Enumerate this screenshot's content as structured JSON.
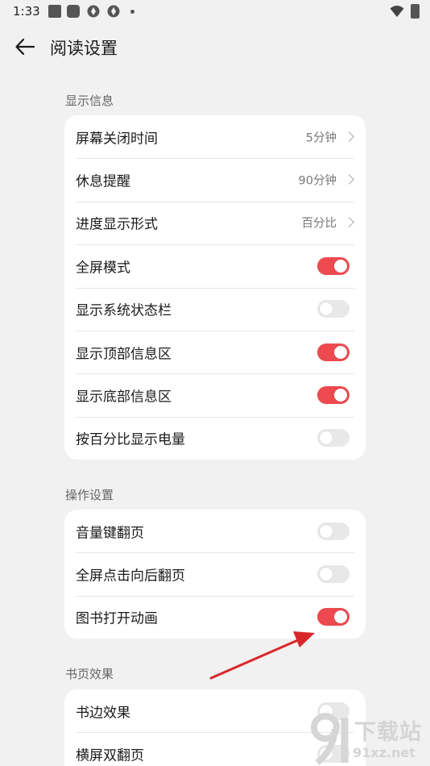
{
  "status_bar": {
    "time": "1:33"
  },
  "header": {
    "title": "阅读设置"
  },
  "sections": [
    {
      "title": "显示信息",
      "rows": [
        {
          "label": "屏幕关闭时间",
          "type": "nav",
          "value": "5分钟"
        },
        {
          "label": "休息提醒",
          "type": "nav",
          "value": "90分钟"
        },
        {
          "label": "进度显示形式",
          "type": "nav",
          "value": "百分比"
        },
        {
          "label": "全屏模式",
          "type": "toggle",
          "on": true
        },
        {
          "label": "显示系统状态栏",
          "type": "toggle",
          "on": false
        },
        {
          "label": "显示顶部信息区",
          "type": "toggle",
          "on": true
        },
        {
          "label": "显示底部信息区",
          "type": "toggle",
          "on": true
        },
        {
          "label": "按百分比显示电量",
          "type": "toggle",
          "on": false
        }
      ]
    },
    {
      "title": "操作设置",
      "rows": [
        {
          "label": "音量键翻页",
          "type": "toggle",
          "on": false
        },
        {
          "label": "全屏点击向后翻页",
          "type": "toggle",
          "on": false
        },
        {
          "label": "图书打开动画",
          "type": "toggle",
          "on": true
        }
      ]
    },
    {
      "title": "书页效果",
      "rows": [
        {
          "label": "书边效果",
          "type": "toggle",
          "on": false
        },
        {
          "label": "横屏双翻页",
          "type": "toggle",
          "on": false
        }
      ]
    }
  ],
  "watermark": {
    "brand": "下载站",
    "site": "91xz.net"
  },
  "colors": {
    "accent": "#ec4a4f",
    "background": "#f1f1f1",
    "card": "#ffffff",
    "annotation_arrow": "#d9262b"
  }
}
